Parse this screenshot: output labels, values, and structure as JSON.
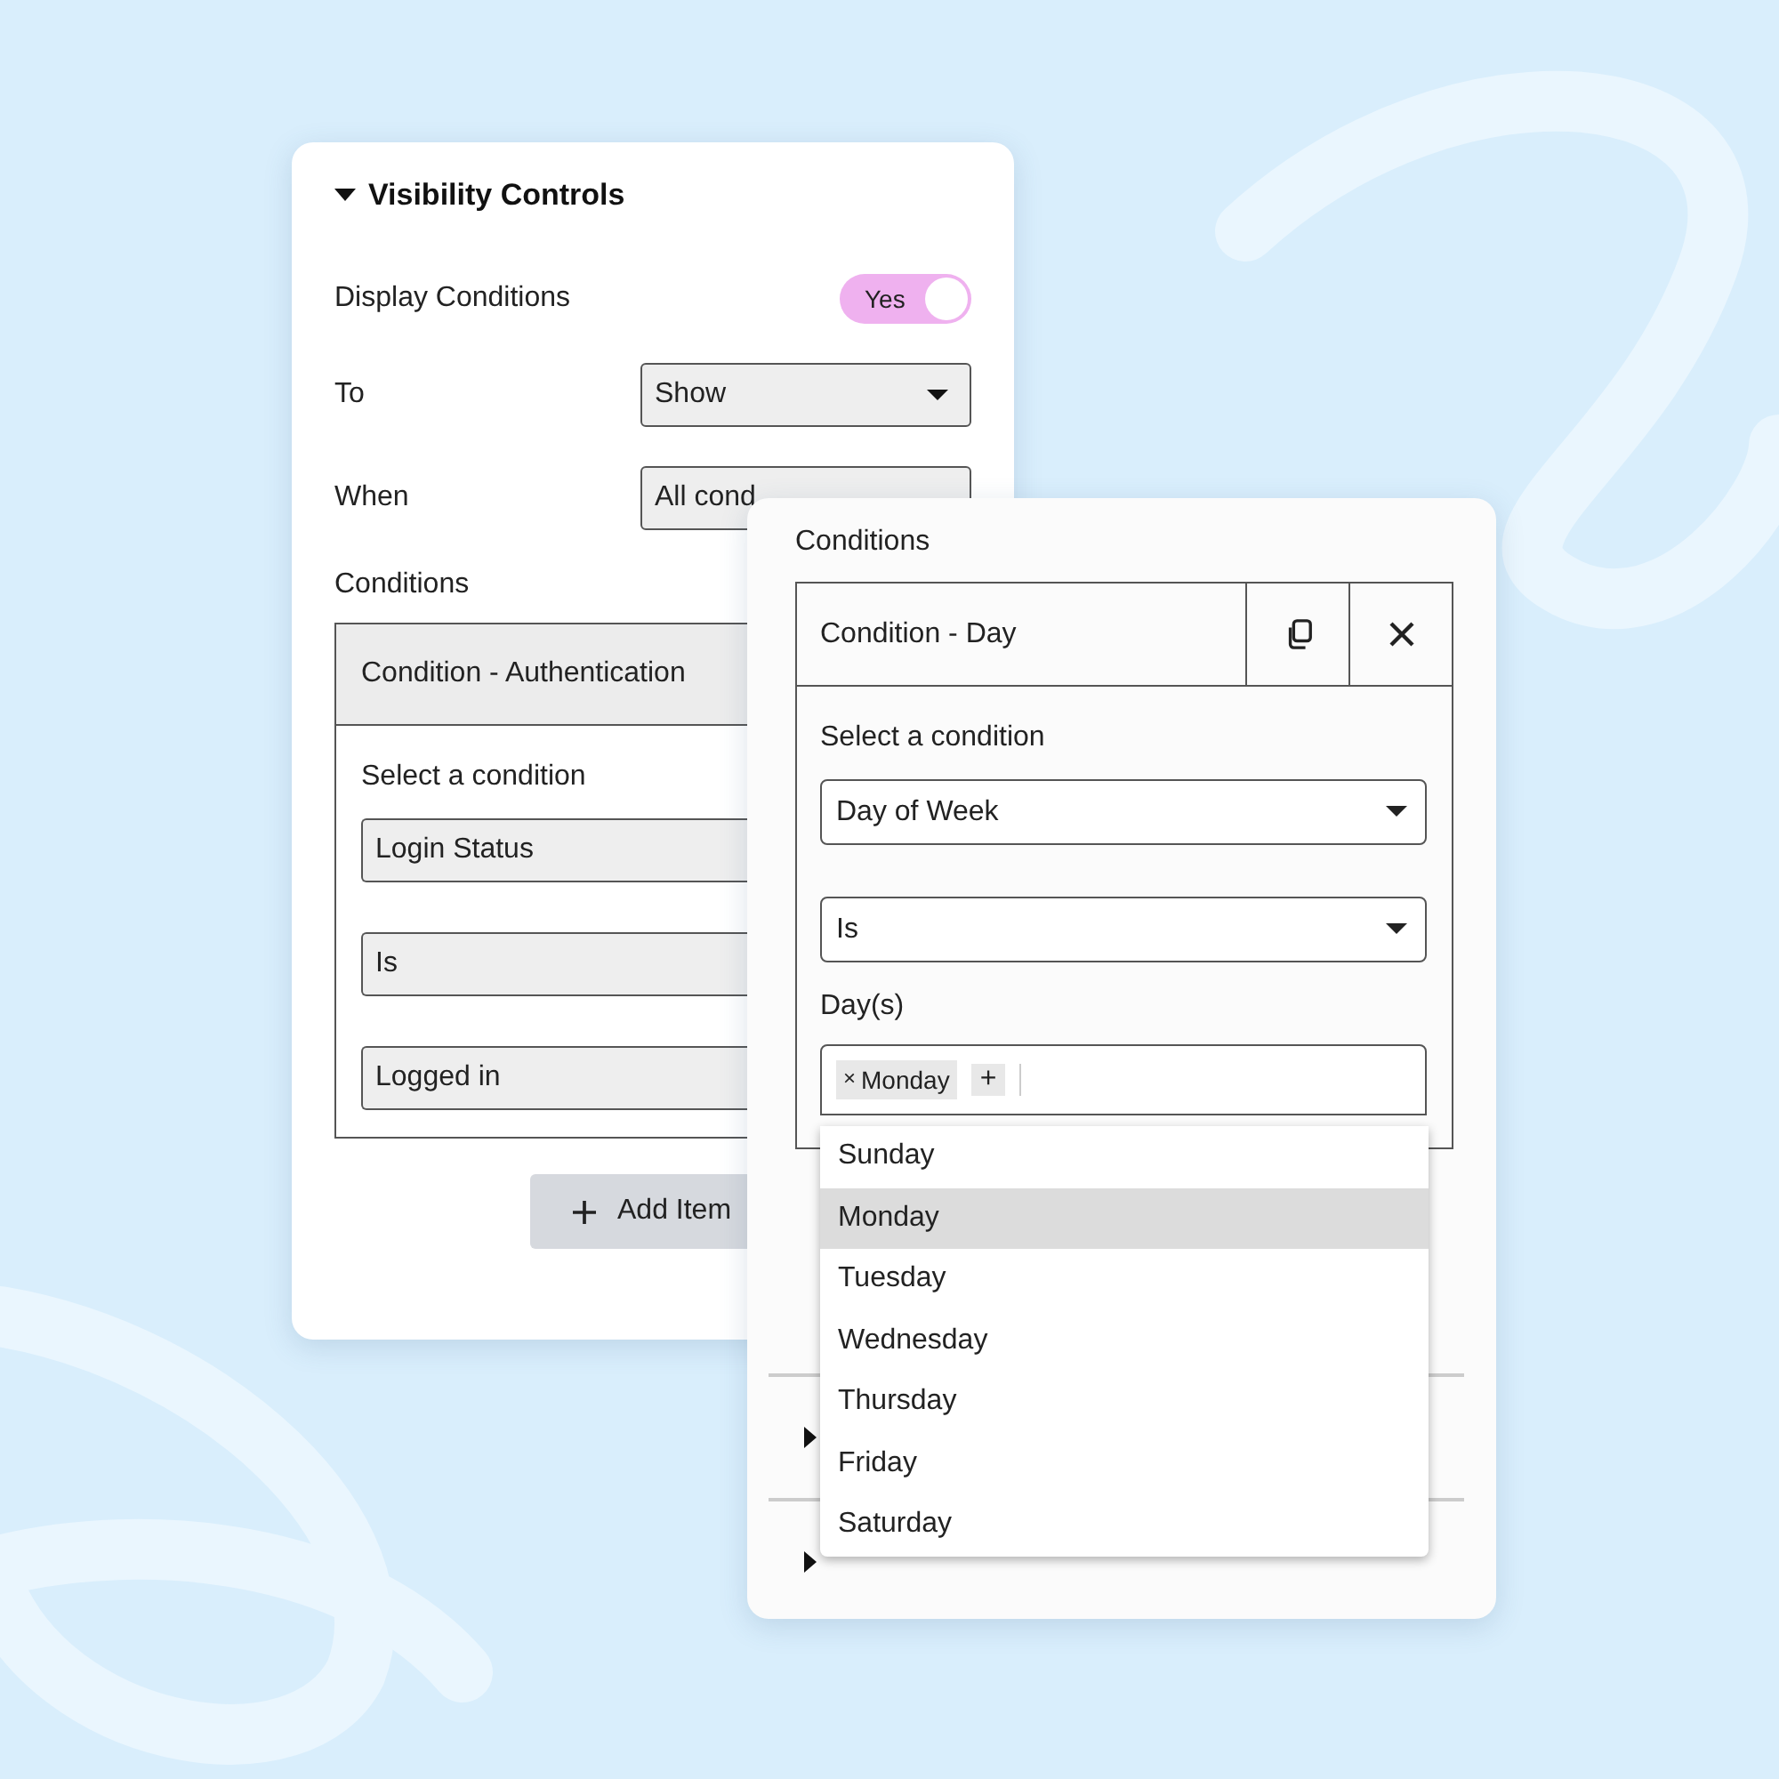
{
  "visibility_panel": {
    "title": "Visibility Controls",
    "expanded": true,
    "display_conditions": {
      "label": "Display Conditions",
      "toggle_text": "Yes",
      "on": true
    },
    "to": {
      "label": "To",
      "value": "Show"
    },
    "when": {
      "label": "When",
      "value": "All cond"
    },
    "conditions_label": "Conditions",
    "condition": {
      "title": "Condition - Authentication",
      "select_label": "Select a condition",
      "fields": [
        "Login Status",
        "Is",
        "Logged in"
      ]
    },
    "add_button": "Add Item"
  },
  "conditions_panel": {
    "label": "Conditions",
    "condition": {
      "title": "Condition - Day",
      "select_label": "Select a condition",
      "condition_value": "Day of Week",
      "operator_value": "Is",
      "days_label": "Day(s)",
      "tags": [
        {
          "remove": "×",
          "label": "Monday"
        }
      ],
      "add_tag": "+",
      "options": [
        {
          "label": "Sunday",
          "selected": false
        },
        {
          "label": "Monday",
          "selected": true
        },
        {
          "label": "Tuesday",
          "selected": false
        },
        {
          "label": "Wednesday",
          "selected": false
        },
        {
          "label": "Thursday",
          "selected": false
        },
        {
          "label": "Friday",
          "selected": false
        },
        {
          "label": "Saturday",
          "selected": false
        }
      ]
    }
  }
}
